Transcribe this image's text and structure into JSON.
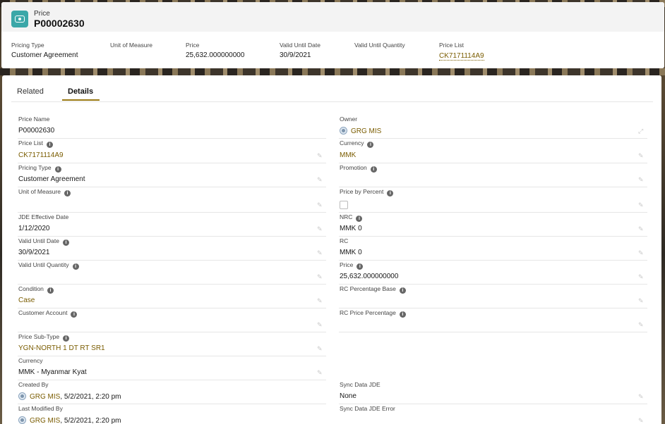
{
  "header": {
    "object_type": "Price",
    "record_name": "P00002630",
    "highlights": [
      {
        "label": "Pricing Type",
        "value": "Customer Agreement",
        "link": false
      },
      {
        "label": "Unit of Measure",
        "value": "",
        "link": false
      },
      {
        "label": "Price",
        "value": "25,632.000000000",
        "link": false
      },
      {
        "label": "Valid Until Date",
        "value": "30/9/2021",
        "link": false
      },
      {
        "label": "Valid Until Quantity",
        "value": "",
        "link": false
      },
      {
        "label": "Price List",
        "value": "CK7171114A9",
        "link": true
      }
    ]
  },
  "tabs": [
    {
      "label": "Related",
      "active": false
    },
    {
      "label": "Details",
      "active": true
    }
  ],
  "left_fields": [
    {
      "label": "Price Name",
      "value": "P00002630",
      "info": false
    },
    {
      "label": "Price List",
      "value": "CK7171114A9",
      "info": true
    },
    {
      "label": "Pricing Type",
      "value": "Customer Agreement",
      "info": true
    },
    {
      "label": "Unit of Measure",
      "value": "",
      "info": true
    },
    {
      "label": "JDE Effective Date",
      "value": "1/12/2020",
      "info": false
    },
    {
      "label": "Valid Until Date",
      "value": "30/9/2021",
      "info": true
    },
    {
      "label": "Valid Until Quantity",
      "value": "",
      "info": true
    },
    {
      "label": "Condition",
      "value": "Case",
      "info": true
    },
    {
      "label": "Customer Account",
      "value": "",
      "info": true
    },
    {
      "label": "Price Sub-Type",
      "value": "YGN-NORTH 1 DT RT SR1",
      "info": true
    },
    {
      "label": "Currency",
      "value": "MMK - Myanmar Kyat",
      "info": false
    },
    {
      "label": "Created By",
      "value": "GRG MIS",
      "suffix": ", 5/2/2021, 2:20 pm",
      "info": false
    },
    {
      "label": "Last Modified By",
      "value": "GRG MIS",
      "suffix": ", 5/2/2021, 2:20 pm",
      "info": false
    }
  ],
  "right_fields": [
    {
      "label": "Owner",
      "value": "GRG MIS",
      "info": false
    },
    {
      "label": "Currency",
      "value": "MMK",
      "info": true
    },
    {
      "label": "Promotion",
      "value": "",
      "info": true
    },
    {
      "label": "Price by Percent",
      "value": "",
      "info": true
    },
    {
      "label": "NRC",
      "value": "MMK 0",
      "info": true
    },
    {
      "label": "RC",
      "value": "MMK 0",
      "info": false
    },
    {
      "label": "Price",
      "value": "25,632.000000000",
      "info": true
    },
    {
      "label": "RC Percentage Base",
      "value": "",
      "info": true
    },
    {
      "label": "RC Price Percentage",
      "value": "",
      "info": true
    },
    {
      "label": "Sync Data JDE",
      "value": "None",
      "info": false
    },
    {
      "label": "Sync Data JDE Error",
      "value": "",
      "info": false
    }
  ],
  "icons": {
    "info": "i",
    "edit": "pencil-icon",
    "object": "eye-icon"
  },
  "colors": {
    "accent": "#3ba7a8",
    "link": "#7a5c00",
    "tab_underline": "#9a7a14"
  }
}
